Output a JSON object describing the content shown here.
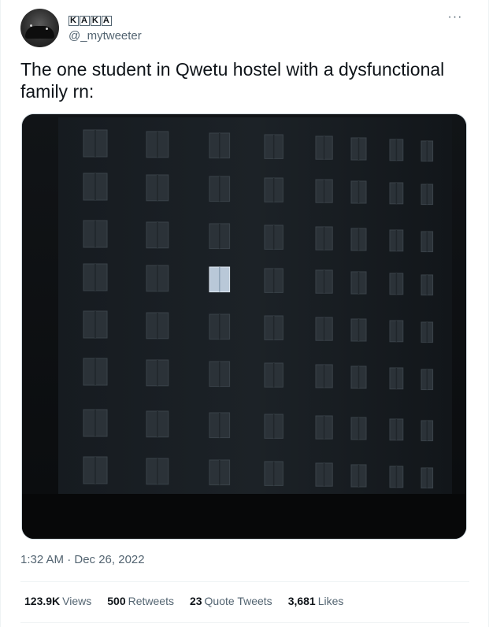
{
  "tweet": {
    "display_name_letters": [
      "K",
      "A",
      "K",
      "A"
    ],
    "handle": "@_mytweeter",
    "more_icon": "more-horizontal-icon",
    "text": "The one student in Qwetu hostel with a dysfunctional family rn:",
    "timestamp": "1:32 AM · Dec 26, 2022",
    "media_description_icon": "building-night-photo"
  },
  "stats": {
    "views_count": "123.9K",
    "views_label": "Views",
    "retweets_count": "500",
    "retweets_label": "Retweets",
    "quotes_count": "23",
    "quotes_label": "Quote Tweets",
    "likes_count": "3,681",
    "likes_label": "Likes"
  }
}
